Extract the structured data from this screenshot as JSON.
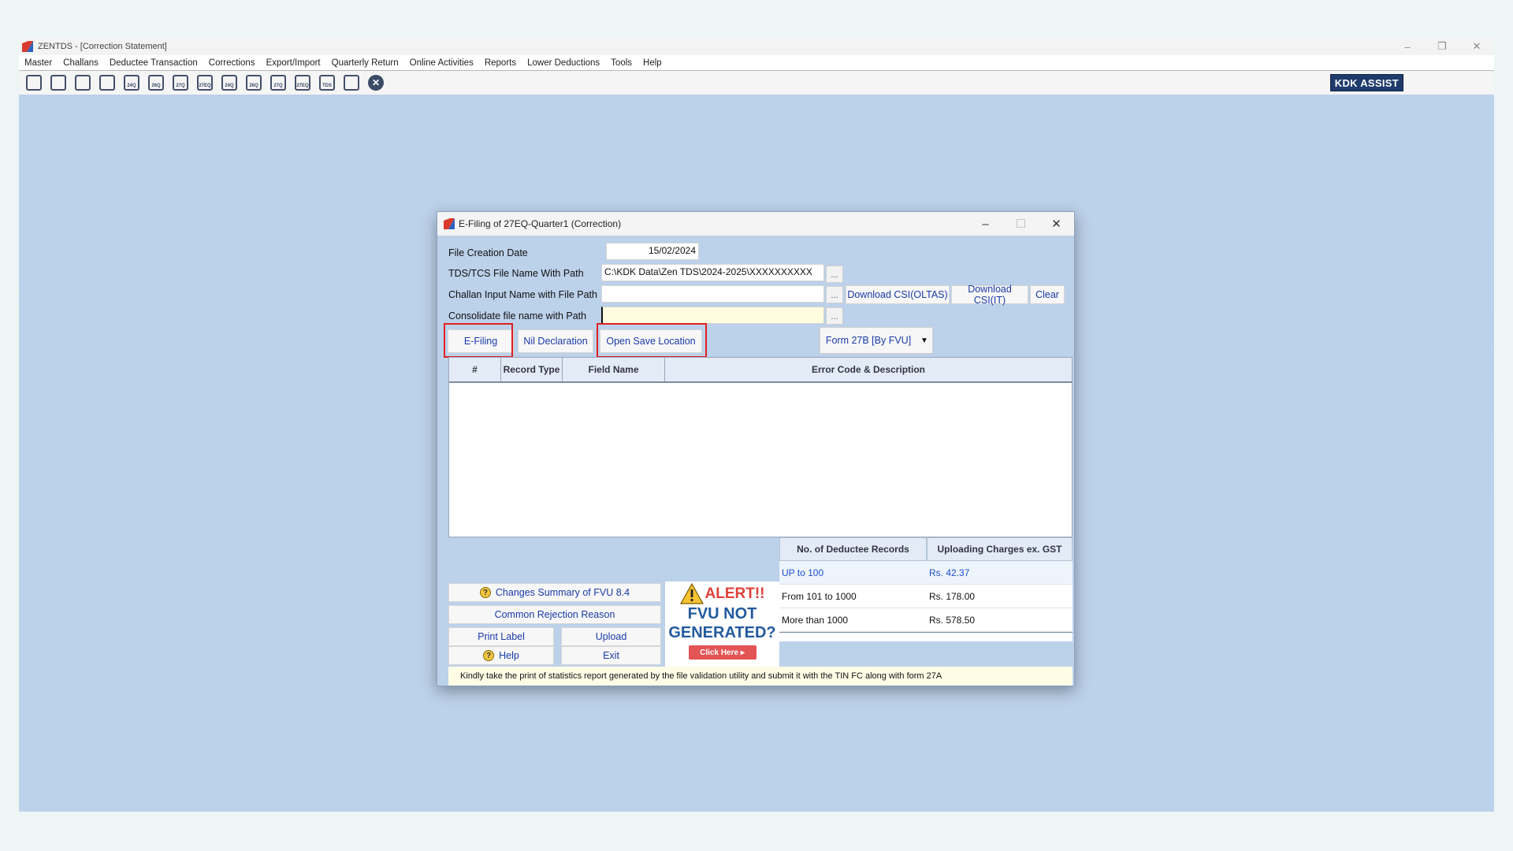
{
  "app": {
    "title": "ZENTDS - [Correction Statement]",
    "window_controls": {
      "minimize": "–",
      "restore": "❐",
      "close": "✕"
    },
    "menu": [
      "Master",
      "Challans",
      "Deductee Transaction",
      "Corrections",
      "Export/Import",
      "Quarterly Return",
      "Online Activities",
      "Reports",
      "Lower Deductions",
      "Tools",
      "Help"
    ],
    "toolbar_icons": [
      {
        "name": "deductor-icon",
        "label": ""
      },
      {
        "name": "deductees-icon",
        "label": ""
      },
      {
        "name": "form-icon",
        "label": ""
      },
      {
        "name": "form2-icon",
        "label": ""
      },
      {
        "name": "form-24q-icon",
        "label": "24Q"
      },
      {
        "name": "form-26q-icon",
        "label": "26Q"
      },
      {
        "name": "form-27q-icon",
        "label": "27Q"
      },
      {
        "name": "form-27eq-icon",
        "label": "27EQ"
      },
      {
        "name": "efile-24q-icon",
        "label": "24Q"
      },
      {
        "name": "efile-26q-icon",
        "label": "26Q"
      },
      {
        "name": "efile-27q-icon",
        "label": "27Q"
      },
      {
        "name": "efile-27eq-icon",
        "label": "27EQ"
      },
      {
        "name": "tds-icon",
        "label": "TDS"
      },
      {
        "name": "report-icon",
        "label": ""
      },
      {
        "name": "close-circle-icon",
        "label": "✕"
      }
    ],
    "kdk_assist": "KDK ASSIST"
  },
  "dialog": {
    "title": "E-Filing of 27EQ-Quarter1 (Correction)",
    "controls": {
      "minimize": "–",
      "maximize": "☐",
      "close": "✕"
    },
    "file_creation_date_label": "File Creation Date",
    "file_creation_date": "15/02/2024",
    "tds_file_label": "TDS/TCS File Name With Path",
    "tds_file_value": "C:\\KDK Data\\Zen TDS\\2024-2025\\XXXXXXXXXX",
    "challan_label": "Challan Input Name with File Path",
    "challan_value": "",
    "consolidate_label": "Consolidate file name with Path",
    "consolidate_value": "",
    "browse": "...",
    "download_csi_oltas": "Download CSI(OLTAS)",
    "download_csi_it": "Download CSI(IT)",
    "clear": "Clear",
    "efiling_btn": "E-Filing",
    "nil_declaration_btn": "Nil Declaration",
    "open_save_location_btn": "Open Save Location",
    "form_select": "Form 27B [By FVU]",
    "grid_headers": [
      "#",
      "Record Type",
      "Field Name",
      "Error Code & Description"
    ],
    "charges": {
      "headers": [
        "No. of Deductee Records",
        "Uploading Charges ex. GST"
      ],
      "rows": [
        {
          "range": "UP to 100",
          "charge": "Rs. 42.37"
        },
        {
          "range": "From 101 to 1000",
          "charge": "Rs. 178.00"
        },
        {
          "range": "More than 1000",
          "charge": "Rs. 578.50"
        }
      ]
    },
    "changes_summary": "Changes Summary of FVU 8.4",
    "common_rejection": "Common Rejection Reason",
    "print_label": "Print Label",
    "upload": "Upload",
    "help": "Help",
    "exit": "Exit",
    "alert": {
      "title": "ALERT!!",
      "line1": "FVU NOT",
      "line2": "GENERATED?",
      "click": "Click Here ▸"
    },
    "status_message": "Kindly take the print of statistics report generated by the file validation utility and submit it with the TIN FC along with form 27A"
  }
}
